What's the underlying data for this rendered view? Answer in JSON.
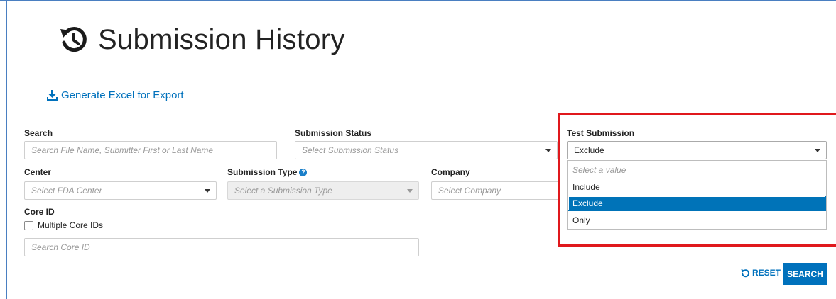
{
  "page": {
    "title": "Submission History",
    "title_icon": "history-icon"
  },
  "export": {
    "label": "Generate Excel for Export",
    "icon": "download-icon"
  },
  "filters": {
    "search": {
      "label": "Search",
      "placeholder": "Search File Name, Submitter First or Last Name"
    },
    "submission_status": {
      "label": "Submission Status",
      "placeholder": "Select Submission Status"
    },
    "test_submission": {
      "label": "Test Submission",
      "value": "Exclude",
      "options": [
        "Select a value",
        "Include",
        "Exclude",
        "Only"
      ],
      "selected_option": "Exclude"
    },
    "center": {
      "label": "Center",
      "placeholder": "Select FDA Center"
    },
    "submission_type": {
      "label": "Submission Type",
      "placeholder": "Select a Submission Type",
      "help_icon": "question-circle-icon"
    },
    "company": {
      "label": "Company",
      "placeholder": "Select Company"
    },
    "core_id": {
      "label": "Core ID",
      "checkbox_label": "Multiple Core IDs",
      "placeholder": "Search Core ID"
    }
  },
  "actions": {
    "reset_label": "RESET",
    "search_label": "SEARCH"
  },
  "colors": {
    "accent": "#0071bc",
    "highlight_border": "#e0181c",
    "selected_option": "#0073b8"
  }
}
